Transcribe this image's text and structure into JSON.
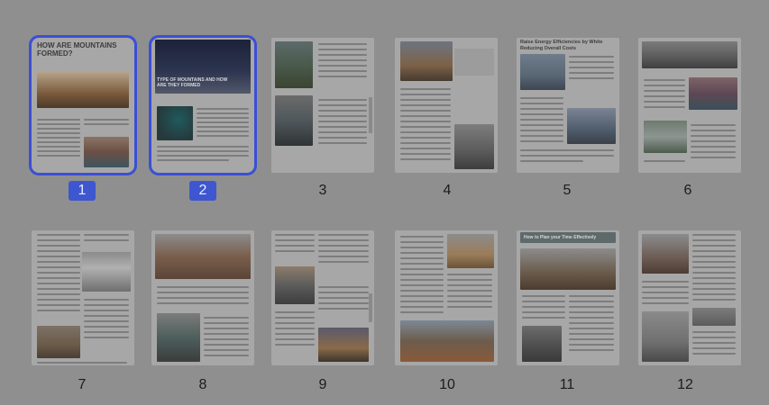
{
  "pages": [
    {
      "number": "1",
      "selected": true,
      "heading": "HOW ARE MOUNTAINS FORMED?"
    },
    {
      "number": "2",
      "selected": true,
      "heading": "TYPE OF MOUNTAINS AND HOW ARE THEY FORMED"
    },
    {
      "number": "3",
      "selected": false,
      "heading": ""
    },
    {
      "number": "4",
      "selected": false,
      "heading": ""
    },
    {
      "number": "5",
      "selected": false,
      "heading": "Raise Energy Efficiencies by White Reducing Overall Costs"
    },
    {
      "number": "6",
      "selected": false,
      "heading": ""
    },
    {
      "number": "7",
      "selected": false,
      "heading": ""
    },
    {
      "number": "8",
      "selected": false,
      "heading": ""
    },
    {
      "number": "9",
      "selected": false,
      "heading": ""
    },
    {
      "number": "10",
      "selected": false,
      "heading": ""
    },
    {
      "number": "11",
      "selected": false,
      "heading": "How to Plan your Time Effectively"
    },
    {
      "number": "12",
      "selected": false,
      "heading": ""
    }
  ],
  "colors": {
    "background": "#8f8f8f",
    "selection": "#3b4fd6",
    "badge": "#3e56cf"
  }
}
